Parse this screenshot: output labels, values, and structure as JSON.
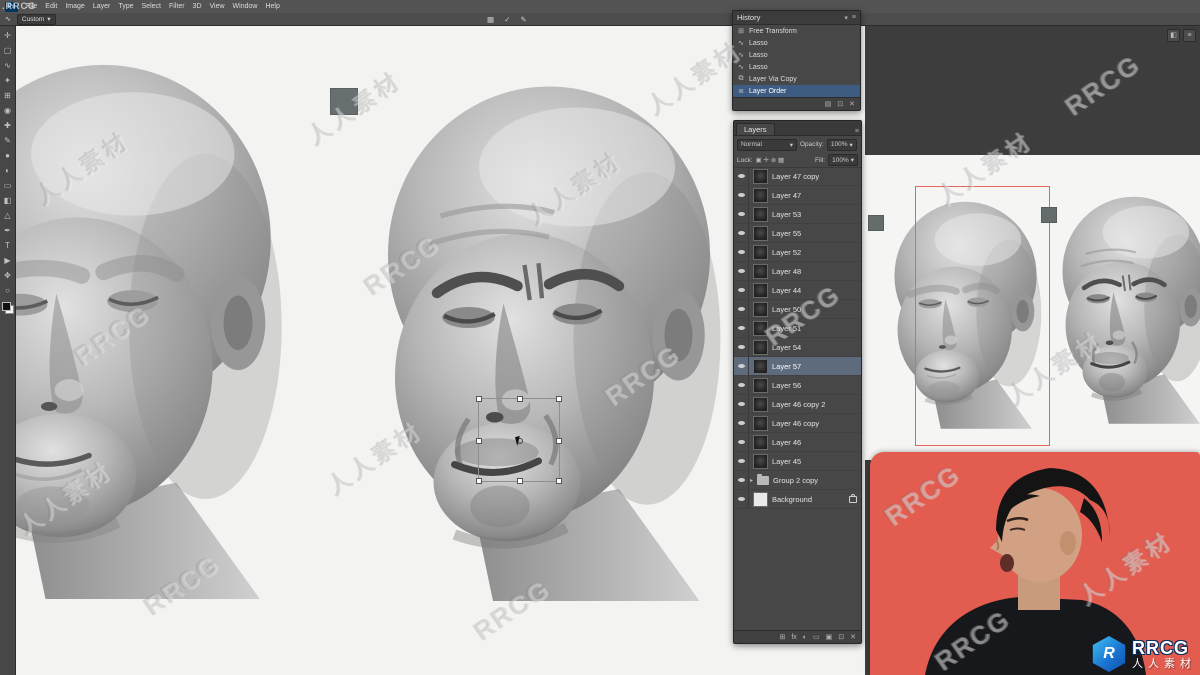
{
  "menubar": {
    "logo": "Ps",
    "items": [
      "File",
      "Edit",
      "Image",
      "Layer",
      "Type",
      "Select",
      "Filter",
      "3D",
      "View",
      "Window",
      "Help"
    ]
  },
  "options": {
    "tool_icon": "∿",
    "preset_value": "Custom",
    "icons": [
      "▦",
      "✓",
      "✎"
    ]
  },
  "tools": {
    "glyphs": [
      "✛",
      "▢",
      "∿",
      "✦",
      "⊞",
      "◉",
      "✚",
      "✎",
      "●",
      "◐",
      "▭",
      "◧",
      "△",
      "✒",
      "T",
      "▶",
      "✥",
      "○"
    ]
  },
  "history_panel": {
    "title": "History",
    "items": [
      {
        "icon": "⊞",
        "label": "Free Transform"
      },
      {
        "icon": "∿",
        "label": "Lasso"
      },
      {
        "icon": "∿",
        "label": "Lasso"
      },
      {
        "icon": "∿",
        "label": "Lasso"
      },
      {
        "icon": "⧉",
        "label": "Layer Via Copy"
      },
      {
        "icon": "≣",
        "label": "Layer Order"
      }
    ],
    "footer_icons": [
      "▤",
      "⊡",
      "✕"
    ]
  },
  "layers_panel": {
    "tab": "Layers",
    "blend_mode": "Normal",
    "opacity_label": "Opacity:",
    "opacity_value": "100%",
    "lock_label": "Lock:",
    "lock_icons": "▣ ✛ ⊕ ▦",
    "fill_label": "Fill:",
    "fill_value": "100%",
    "selected_layer": "Layer 57",
    "layers": [
      {
        "name": "Layer 47 copy"
      },
      {
        "name": "Layer 47"
      },
      {
        "name": "Layer 53"
      },
      {
        "name": "Layer 55"
      },
      {
        "name": "Layer 52"
      },
      {
        "name": "Layer 48"
      },
      {
        "name": "Layer 44"
      },
      {
        "name": "Layer 50"
      },
      {
        "name": "Layer 51"
      },
      {
        "name": "Layer 54"
      },
      {
        "name": "Layer 57"
      },
      {
        "name": "Layer 56"
      },
      {
        "name": "Layer 46 copy 2"
      },
      {
        "name": "Layer 46 copy"
      },
      {
        "name": "Layer 46"
      },
      {
        "name": "Layer 45"
      },
      {
        "name": "Group 2 copy",
        "type": "group"
      },
      {
        "name": "Background",
        "type": "background"
      }
    ],
    "footer_icons": [
      "⊞",
      "fx",
      "◐",
      "▭",
      "▣",
      "⊡",
      "✕"
    ]
  },
  "colors": {
    "webcam_bg": "#e25c50",
    "ref_frame": "#e0685c",
    "canvas_swatch": "#68706f",
    "history_selection": "#3e5c82",
    "layer_selection": "#5d6b7d"
  },
  "watermark": {
    "brand": "RRCG",
    "cn": "人人素材",
    "tiny": ".RRCG"
  },
  "logo": {
    "emblem_letter": "R",
    "brand": "RRCG",
    "cn": "人人素材"
  }
}
